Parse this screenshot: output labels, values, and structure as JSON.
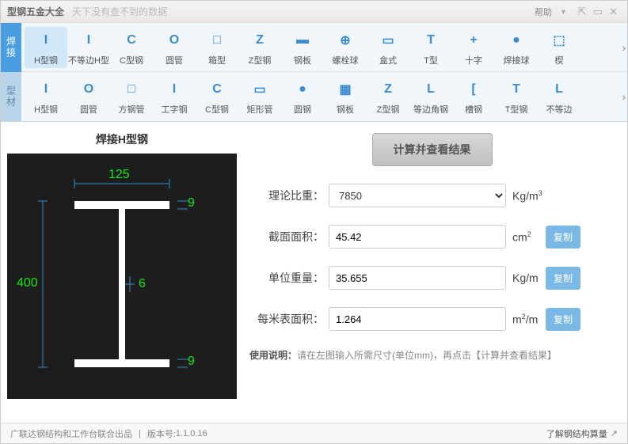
{
  "titlebar": {
    "title": "型钢五金大全",
    "subtitle": "天下没有查不到的数据",
    "help": "帮助"
  },
  "side_tabs": [
    {
      "label": "焊接"
    },
    {
      "label": "型材"
    }
  ],
  "toolbar_row1": [
    {
      "label": "H型钢",
      "icon": "I"
    },
    {
      "label": "不等边H型",
      "icon": "I"
    },
    {
      "label": "C型钢",
      "icon": "C"
    },
    {
      "label": "圆管",
      "icon": "O"
    },
    {
      "label": "箱型",
      "icon": "□"
    },
    {
      "label": "Z型钢",
      "icon": "Z"
    },
    {
      "label": "钢板",
      "icon": "▬"
    },
    {
      "label": "螺栓球",
      "icon": "⊕"
    },
    {
      "label": "盒式",
      "icon": "▭"
    },
    {
      "label": "T型",
      "icon": "T"
    },
    {
      "label": "十字",
      "icon": "+"
    },
    {
      "label": "焊接球",
      "icon": "●"
    },
    {
      "label": "楔",
      "icon": "⬚"
    }
  ],
  "toolbar_row2": [
    {
      "label": "H型钢",
      "icon": "I"
    },
    {
      "label": "圆管",
      "icon": "O"
    },
    {
      "label": "方钢管",
      "icon": "□"
    },
    {
      "label": "工字钢",
      "icon": "I"
    },
    {
      "label": "C型钢",
      "icon": "C"
    },
    {
      "label": "矩形管",
      "icon": "▭"
    },
    {
      "label": "圆钢",
      "icon": "●"
    },
    {
      "label": "钢板",
      "icon": "▦"
    },
    {
      "label": "Z型钢",
      "icon": "Z"
    },
    {
      "label": "等边角钢",
      "icon": "L"
    },
    {
      "label": "槽钢",
      "icon": "["
    },
    {
      "label": "T型钢",
      "icon": "T"
    },
    {
      "label": "不等边",
      "icon": "L"
    }
  ],
  "section_title": "焊接H型钢",
  "diagram": {
    "width": "125",
    "height": "400",
    "web": "6",
    "flange_t": "9",
    "flange_b": "9"
  },
  "calc_button": "计算并查看结果",
  "fields": {
    "density": {
      "label": "理论比重：",
      "value": "7850",
      "unit": "Kg/m³"
    },
    "area": {
      "label": "截面面积：",
      "value": "45.42",
      "unit": "cm²"
    },
    "weight": {
      "label": "单位重量：",
      "value": "35.655",
      "unit": "Kg/m"
    },
    "surface": {
      "label": "每米表面积：",
      "value": "1.264",
      "unit": "m²/m"
    }
  },
  "copy_label": "复制",
  "usage_prefix": "使用说明：",
  "usage_text": "请在左图输入所需尺寸(单位mm)，再点击【计算并查看结果】",
  "footer": {
    "credit": "广联达钢结构和工作台联合出品",
    "sep": "|",
    "version_label": "版本号:",
    "version": "1.1.0.16",
    "link": "了解钢结构算量"
  }
}
